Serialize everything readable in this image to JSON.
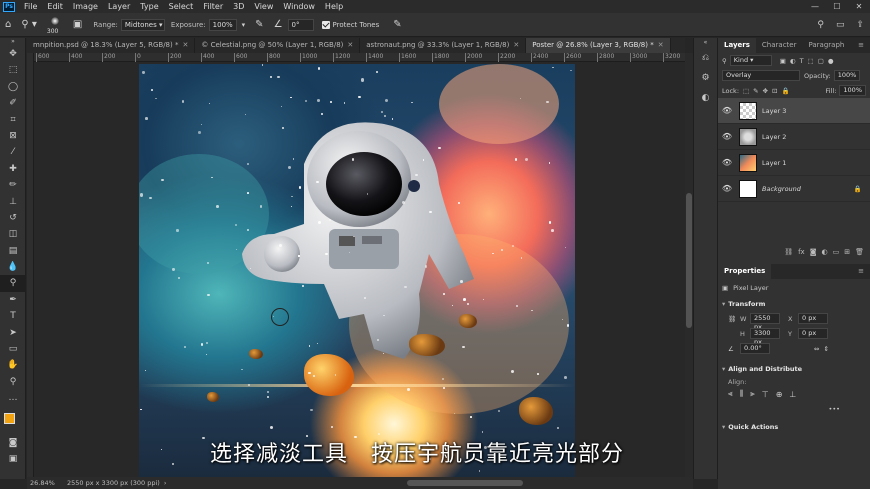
{
  "menubar": {
    "logo": "Ps",
    "items": [
      "File",
      "Edit",
      "Image",
      "Layer",
      "Type",
      "Select",
      "Filter",
      "3D",
      "View",
      "Window",
      "Help"
    ],
    "win_controls": [
      "—",
      "☐",
      "✕"
    ]
  },
  "options": {
    "brush_size": "300",
    "range_label": "Range:",
    "range_value": "Midtones",
    "exposure_label": "Exposure:",
    "exposure_value": "100%",
    "angle_value": "0°",
    "protect_tones_label": "Protect Tones"
  },
  "tabs": [
    {
      "label": "mnpition.psd @ 18.3% (Layer 5, RGB/8) *"
    },
    {
      "label": "© Celestial.png @ 50% (Layer 1, RGB/8)"
    },
    {
      "label": "astronaut.png @ 33.3% (Layer 1, RGB/8)"
    },
    {
      "label": "Poster @ 26.8% (Layer 3, RGB/8) *",
      "active": true
    }
  ],
  "ruler_ticks": [
    "600",
    "400",
    "200",
    "0",
    "200",
    "400",
    "600",
    "800",
    "1000",
    "1200",
    "1400",
    "1600",
    "1800",
    "2000",
    "2200",
    "2400",
    "2600",
    "2800",
    "3000",
    "3200"
  ],
  "status": {
    "zoom": "26.84%",
    "doc_info": "2550 px x 3300 px (300 ppi)"
  },
  "subtitle": "选择减淡工具　按压宇航员靠近亮光部分",
  "panels": {
    "tabs": [
      "Layers",
      "Character",
      "Paragraph"
    ],
    "kind_label": "Kind",
    "blend_mode": "Overlay",
    "opacity_label": "Opacity:",
    "opacity_value": "100%",
    "lock_label": "Lock:",
    "fill_label": "Fill:",
    "fill_value": "100%",
    "layers": [
      {
        "name": "Layer 3",
        "selected": true
      },
      {
        "name": "Layer 2"
      },
      {
        "name": "Layer 1"
      },
      {
        "name": "Background",
        "locked": true
      }
    ],
    "properties_title": "Properties",
    "pixel_layer_label": "Pixel Layer",
    "transform_title": "Transform",
    "w_label": "W",
    "w_value": "2550 px",
    "h_label": "H",
    "h_value": "3300 px",
    "x_label": "X",
    "x_value": "0 px",
    "y_label": "Y",
    "y_value": "0 px",
    "angle_value": "0.00°",
    "align_title": "Align and Distribute",
    "align_label": "Align:",
    "quick_actions_title": "Quick Actions"
  },
  "colors": {
    "foreground": "#f2a311",
    "background": "#111111"
  }
}
